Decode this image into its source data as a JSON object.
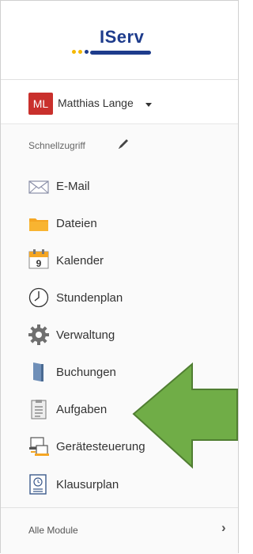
{
  "brand": {
    "name": "IServ"
  },
  "user": {
    "initials": "ML",
    "name": "Matthias Lange"
  },
  "quick_access": {
    "label": "Schnellzugriff"
  },
  "menu": [
    {
      "label": "E-Mail",
      "icon": "mail-icon"
    },
    {
      "label": "Dateien",
      "icon": "folder-icon"
    },
    {
      "label": "Kalender",
      "icon": "calendar-icon"
    },
    {
      "label": "Stundenplan",
      "icon": "clock-icon"
    },
    {
      "label": "Verwaltung",
      "icon": "gear-icon"
    },
    {
      "label": "Buchungen",
      "icon": "door-icon"
    },
    {
      "label": "Aufgaben",
      "icon": "clipboard-icon"
    },
    {
      "label": "Gerätesteuerung",
      "icon": "devices-icon"
    },
    {
      "label": "Klausurplan",
      "icon": "exam-plan-icon"
    }
  ],
  "footer": {
    "label": "Alle Module"
  },
  "colors": {
    "brand_blue": "#1e3c8c",
    "avatar_red": "#c9302c",
    "arrow_green": "#70ad47",
    "arrow_border": "#507e32"
  },
  "calendar_day": "9"
}
